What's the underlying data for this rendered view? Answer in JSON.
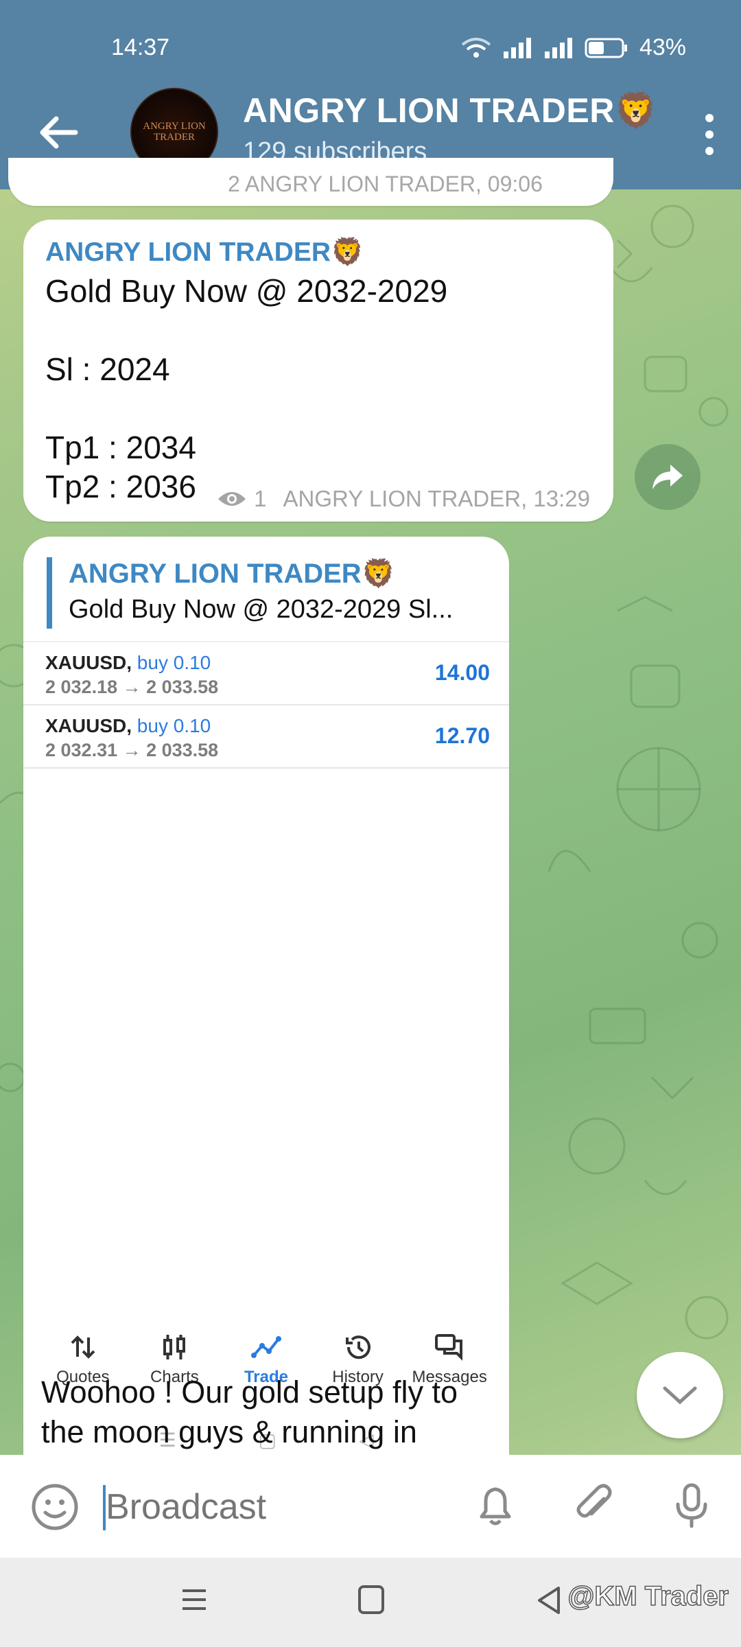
{
  "status_bar": {
    "time": "14:37",
    "battery": "43%"
  },
  "header": {
    "title": "ANGRY LION TRADER🦁",
    "subtitle": "129 subscribers",
    "avatar_text_line1": "ANGRY LION",
    "avatar_text_line2": "TRADER"
  },
  "prev_message": {
    "meta": "2  ANGRY LION TRADER, 09:06"
  },
  "message1": {
    "author": "ANGRY LION TRADER🦁",
    "text": "Gold Buy Now @ 2032-2029\n\nSl : 2024\n\nTp1 : 2034\nTp2 : 2036",
    "views": "1",
    "signature": "ANGRY LION TRADER, 13:29"
  },
  "message2": {
    "reply_author": "ANGRY LION TRADER🦁",
    "reply_text": "Gold Buy Now @ 2032-2029  Sl...",
    "trades": [
      {
        "symbol": "XAUUSD,",
        "side": "buy 0.10",
        "prices": "2 032.18 → 2 033.58",
        "profit": "14.00"
      },
      {
        "symbol": "XAUUSD,",
        "side": "buy 0.10",
        "prices": "2 032.31 → 2 033.58",
        "profit": "12.70"
      }
    ],
    "mt_nav": {
      "quotes": "Quotes",
      "charts": "Charts",
      "trade": "Trade",
      "history": "History",
      "messages": "Messages"
    },
    "mini_nav": {
      "menu": "☰",
      "home": "▢",
      "back": "◁"
    },
    "text": "Woohoo ! Our gold setup fly to the moon guys & running in"
  },
  "composer": {
    "placeholder": "Broadcast"
  },
  "watermark": "@KM Trader",
  "colors": {
    "header": "#5682a3",
    "accent": "#3e88c3",
    "profit": "#1f74d6"
  }
}
